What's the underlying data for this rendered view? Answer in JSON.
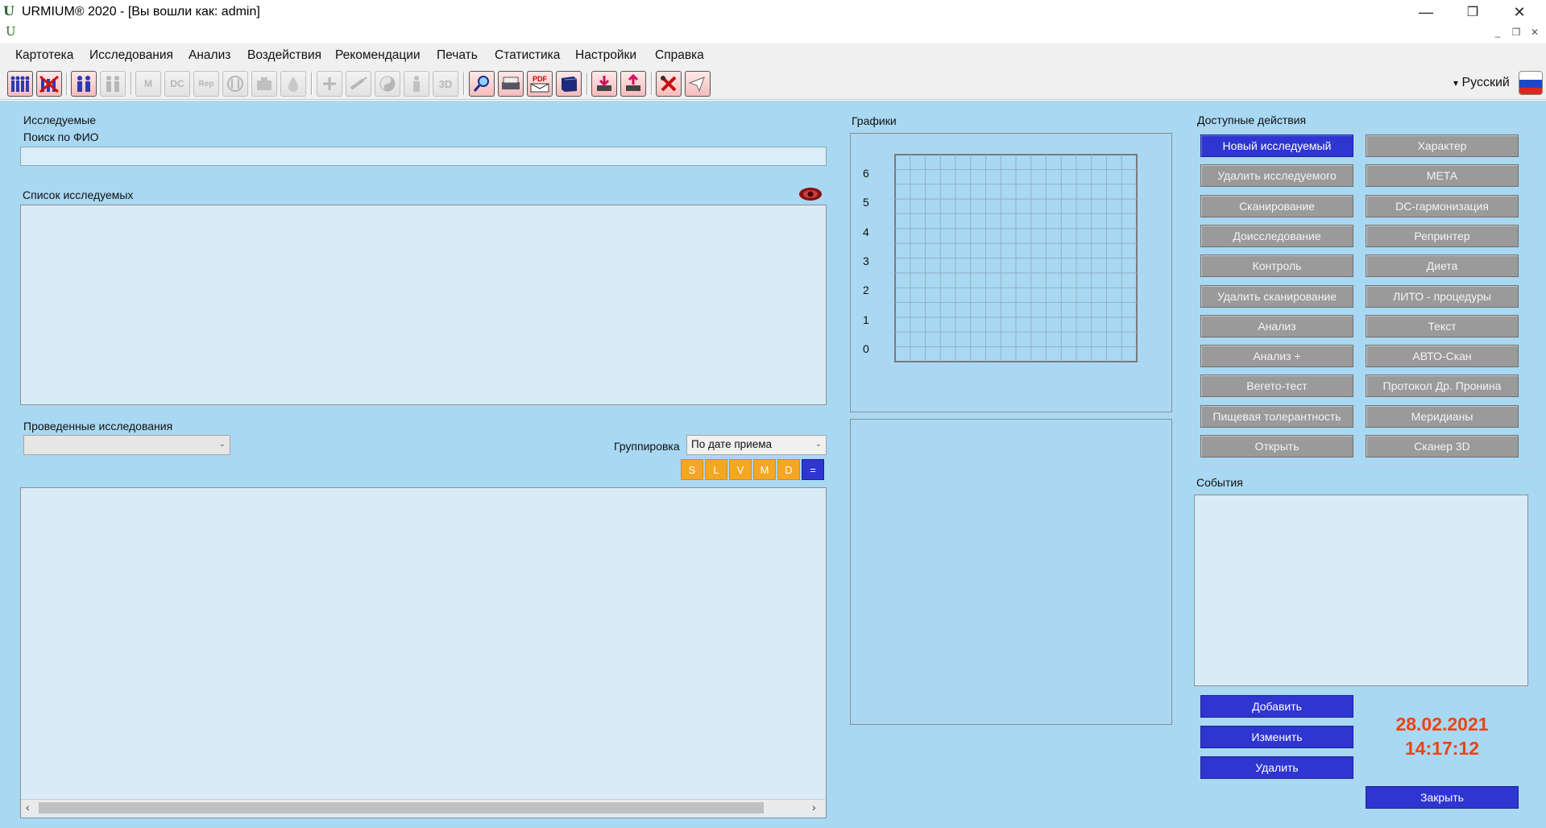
{
  "window": {
    "title": "URMIUM® 2020 - [Вы вошли как: admin]",
    "minimize": "—",
    "maximize": "❐",
    "close": "✕"
  },
  "mdi": {
    "minimize": "_",
    "restore": "❐",
    "close": "✕"
  },
  "menu": [
    "Картотека",
    "Исследования",
    "Анализ",
    "Воздействия",
    "Рекомендации",
    "Печать",
    "Статистика",
    "Настройки",
    "Справка"
  ],
  "toolbar": {
    "buttons": [
      "people-icon",
      "delete-people-icon",
      "people-pair-icon",
      "people-edit-icon",
      "meta-icon",
      "dc-icon",
      "rep-icon",
      "food-icon",
      "box-icon",
      "drop-icon",
      "plus-icon",
      "syringe-icon",
      "yinyang-icon",
      "body-icon",
      "3d-icon",
      "search-icon",
      "scanner-icon",
      "pdf-mail-icon",
      "book-icon",
      "import-icon",
      "export-icon",
      "tools-icon",
      "mail-icon"
    ],
    "labels": {
      "meta": "M",
      "dc": "DC",
      "rep": "Rep",
      "three_d": "3D",
      "pdf": "PDF"
    }
  },
  "language": {
    "label": "Русский",
    "arrow": "▾"
  },
  "subjects": {
    "title": "Исследуемые",
    "search_label": "Поиск по ФИО",
    "search_value": "",
    "list_label": "Список исследуемых"
  },
  "studies": {
    "title": "Проведенные исследования",
    "combo_value": "",
    "grouping_label": "Группировка",
    "grouping_value": "По дате приема",
    "filters": [
      "S",
      "L",
      "V",
      "M",
      "D",
      "="
    ]
  },
  "charts": {
    "title": "Графики"
  },
  "chart_data": {
    "type": "line",
    "title": "",
    "xlabel": "",
    "ylabel": "",
    "ylim": [
      0,
      6
    ],
    "yticks": [
      "6",
      "5",
      "4",
      "3",
      "2",
      "1",
      "0"
    ],
    "grid": true,
    "series": []
  },
  "actions": {
    "title": "Доступные действия",
    "left": [
      "Новый исследуемый",
      "Удалить исследуемого",
      "Сканирование",
      "Доисследование",
      "Контроль",
      "Удалить сканирование",
      "Анализ",
      "Анализ +",
      "Вегето-тест",
      "Пищевая толерантность",
      "Открыть"
    ],
    "right": [
      "Характер",
      "МЕТА",
      "DC-гармонизация",
      "Репринтер",
      "Диета",
      "ЛИТО - процедуры",
      "Текст",
      "АВТО-Скан",
      "Протокол Др. Пронина",
      "Меридианы",
      "Сканер 3D"
    ]
  },
  "events": {
    "title": "События",
    "add": "Добавить",
    "edit": "Изменить",
    "delete": "Удалить",
    "close": "Закрыть",
    "date": "28.02.2021",
    "time": "14:17:12"
  },
  "colors": {
    "panel_bg": "#a9d8f2",
    "list_bg": "#d8ecf8",
    "primary_button": "#2f35d0",
    "inactive_button": "#9a9a9a",
    "filter_button": "#f5a623",
    "datetime": "#ee4411"
  }
}
